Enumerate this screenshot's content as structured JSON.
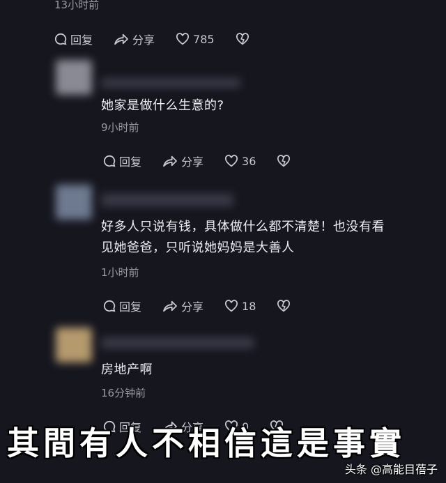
{
  "comments": [
    {
      "time": "13小时前",
      "reply_label": "回复",
      "share_label": "分享",
      "like_count": "785"
    },
    {
      "text": "她家是做什么生意的?",
      "time": "9小时前",
      "reply_label": "回复",
      "share_label": "分享",
      "like_count": "36"
    },
    {
      "text_line1": "好多人只说有钱，具体做什么都不清楚！也没有看",
      "text_line2": "见她爸爸，只听说她妈妈是大善人",
      "time": "1小时前",
      "reply_label": "回复",
      "share_label": "分享",
      "like_count": "18"
    },
    {
      "text": "房地产啊",
      "time": "16分钟前",
      "reply_label": "回复",
      "share_label": "分享",
      "like_count": "0"
    }
  ],
  "caption": "其間有人不相信這是事實",
  "watermark": "头条 @高能目蓓子",
  "colors": {
    "background": "#16161f",
    "text": "#ededf2",
    "muted": "#9a9aa6"
  },
  "icons": [
    "comment-icon",
    "share-icon",
    "heart-icon",
    "dislike-icon"
  ]
}
